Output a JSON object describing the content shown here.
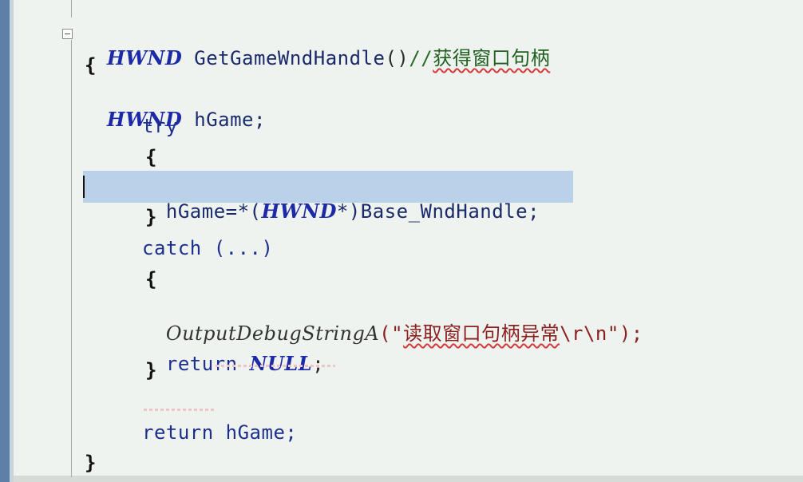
{
  "code": {
    "line_function_signature": {
      "return_type": "HWND",
      "name": "GetGameWndHandle",
      "parens": "()",
      "comment_prefix": "//",
      "comment_text": "获得窗口句柄"
    },
    "line_open_brace": "{",
    "line_decl": {
      "type": "HWND",
      "rest": " hGame;"
    },
    "line_try": "try",
    "line_try_open": "{",
    "line_assign": {
      "pre": "hGame=*(",
      "type": "HWND",
      "post": "*)Base_WndHandle;"
    },
    "line_try_close": "}",
    "line_catch": "catch (...)",
    "line_catch_open": "{",
    "line_output": {
      "fn": "OutputDebugStringA",
      "open": "(\"",
      "cn": "读取窗口句柄异常",
      "tail": "\\r\\n\");"
    },
    "line_return_null": {
      "kw": "return",
      "value": "NULL",
      "end": ";"
    },
    "line_catch_close": "}",
    "line_return_hgame": "return hGame;",
    "line_close_brace": "}"
  }
}
